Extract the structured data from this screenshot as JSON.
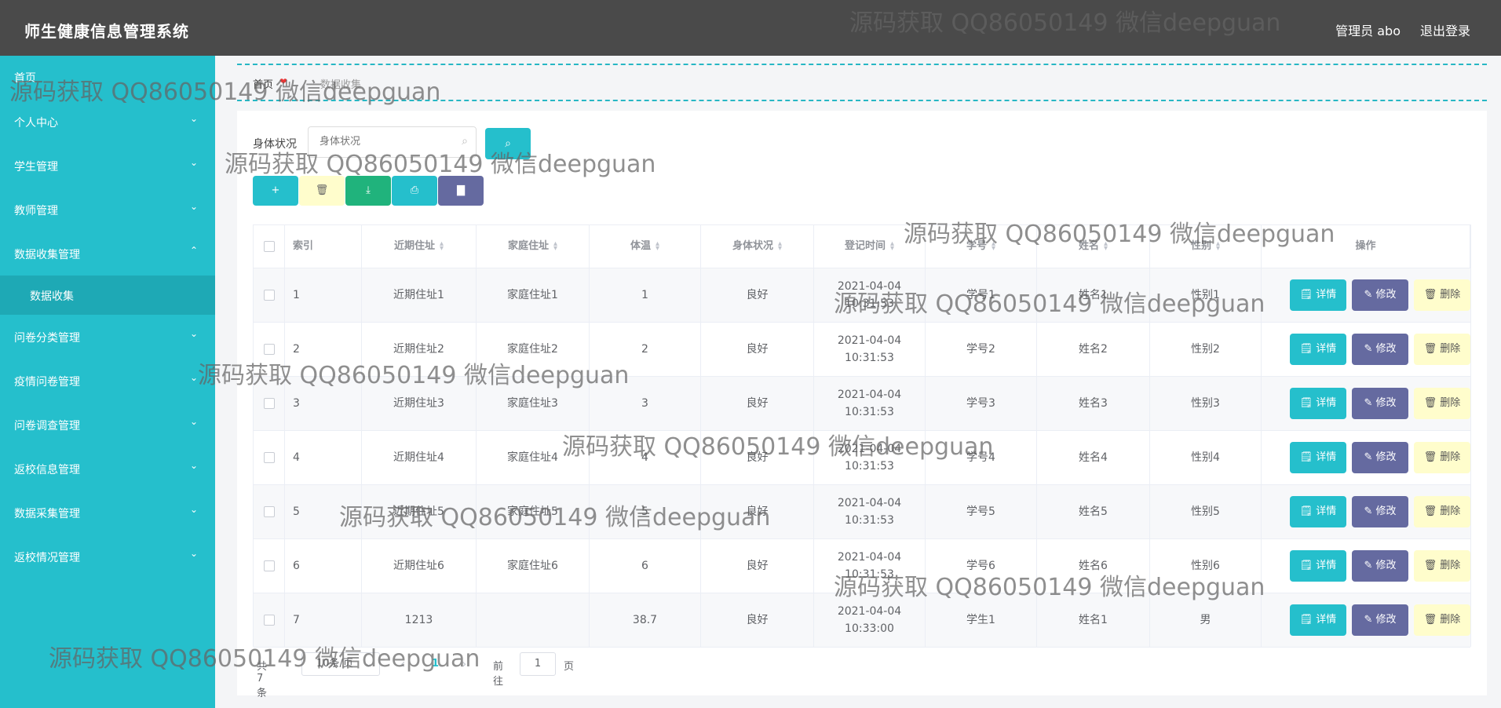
{
  "app": {
    "title": "师生健康信息管理系统",
    "user": "管理员 abo",
    "logout": "退出登录"
  },
  "sidebar": {
    "home": "首页",
    "items": [
      {
        "label": "个人中心"
      },
      {
        "label": "学生管理"
      },
      {
        "label": "教师管理"
      },
      {
        "label": "数据收集管理",
        "expanded": true
      },
      {
        "label": "问卷分类管理"
      },
      {
        "label": "疫情问卷管理"
      },
      {
        "label": "问卷调查管理"
      },
      {
        "label": "返校信息管理"
      },
      {
        "label": "数据采集管理"
      },
      {
        "label": "返校情况管理"
      }
    ],
    "sub_item": "数据收集"
  },
  "breadcrumb": {
    "home": "首页",
    "sep": "❤",
    "current": "数据收集"
  },
  "search": {
    "label": "身体状况",
    "placeholder": "身体状况",
    "button_icon": "search-icon"
  },
  "toolbar": {
    "add": "+",
    "delete": "🗑",
    "export": "⤓",
    "print": "⎙",
    "chart": "▇"
  },
  "colors": {
    "accent": "#25bfcc",
    "edit": "#656aa0",
    "delete_bg": "#fffdcc",
    "topbar": "#4a4a4a"
  },
  "table": {
    "headers": [
      "索引",
      "近期住址",
      "家庭住址",
      "体温",
      "身体状况",
      "登记时间",
      "学号",
      "姓名",
      "性别",
      "操作"
    ],
    "actions": {
      "detail": "🗒 详情",
      "edit": "✎ 修改",
      "delete": "🗑 删除"
    },
    "rows": [
      [
        "1",
        "近期住址1",
        "家庭住址1",
        "1",
        "良好",
        "2021-04-04 10:31:53",
        "学号1",
        "姓名1",
        "性别1"
      ],
      [
        "2",
        "近期住址2",
        "家庭住址2",
        "2",
        "良好",
        "2021-04-04 10:31:53",
        "学号2",
        "姓名2",
        "性别2"
      ],
      [
        "3",
        "近期住址3",
        "家庭住址3",
        "3",
        "良好",
        "2021-04-04 10:31:53",
        "学号3",
        "姓名3",
        "性别3"
      ],
      [
        "4",
        "近期住址4",
        "家庭住址4",
        "4",
        "良好",
        "2021-04-04 10:31:53",
        "学号4",
        "姓名4",
        "性别4"
      ],
      [
        "5",
        "近期住址5",
        "家庭住址5",
        "5",
        "良好",
        "2021-04-04 10:31:53",
        "学号5",
        "姓名5",
        "性别5"
      ],
      [
        "6",
        "近期住址6",
        "家庭住址6",
        "6",
        "良好",
        "2021-04-04 10:31:53",
        "学号6",
        "姓名6",
        "性别6"
      ],
      [
        "7",
        "1213",
        "",
        "38.7",
        "良好",
        "2021-04-04 10:33:00",
        "学生1",
        "姓名1",
        "男"
      ]
    ]
  },
  "pager": {
    "total": "共 7 条",
    "size": "10条/页",
    "prev": "‹",
    "page": "1",
    "next": "›",
    "goto_prefix": "前往",
    "goto_value": "1",
    "goto_suffix": "页"
  },
  "watermark": "源码获取 QQ86050149 微信deepguan"
}
